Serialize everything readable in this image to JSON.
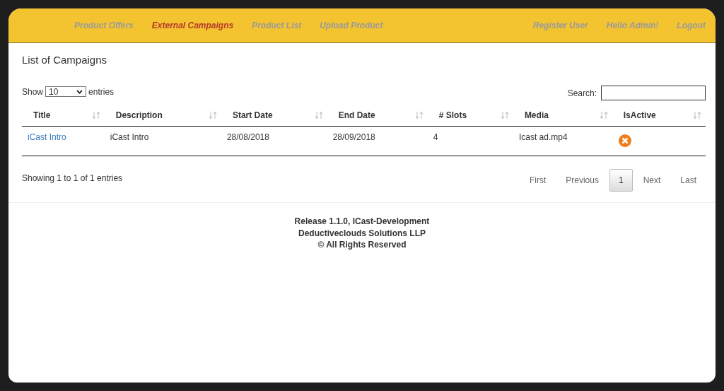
{
  "nav_left": [
    {
      "label": "Product Offers",
      "selected": false
    },
    {
      "label": "External Campaigns",
      "selected": true
    },
    {
      "label": "Product List",
      "selected": false
    },
    {
      "label": "Upload Product",
      "selected": false
    }
  ],
  "nav_right": [
    "Register User",
    "Hello Admin!",
    "Logout"
  ],
  "page_title": "List of Campaigns",
  "length_menu": {
    "before": "Show",
    "value": "10",
    "after": "entries"
  },
  "search": {
    "label": "Search:"
  },
  "table": {
    "columns": [
      "Title",
      "Description",
      "Start Date",
      "End Date",
      "# Slots",
      "Media",
      "IsActive"
    ],
    "rows": [
      {
        "title": "iCast Intro",
        "description": "iCast Intro",
        "start_date": "28/08/2018",
        "end_date": "28/09/2018",
        "slots": "4",
        "media": "Icast ad.mp4",
        "active": false
      }
    ]
  },
  "info": "Showing 1 to 1 of 1 entries",
  "pagination": [
    {
      "label": "First",
      "selected": false
    },
    {
      "label": "Previous",
      "selected": false
    },
    {
      "label": "1",
      "selected": true
    },
    {
      "label": "Next",
      "selected": false
    },
    {
      "label": "Last",
      "selected": false
    }
  ],
  "footer": [
    "Release 1.1.0, ICast-Development",
    "Deductiveclouds Solutions LLP",
    "© All Rights Reserved"
  ]
}
